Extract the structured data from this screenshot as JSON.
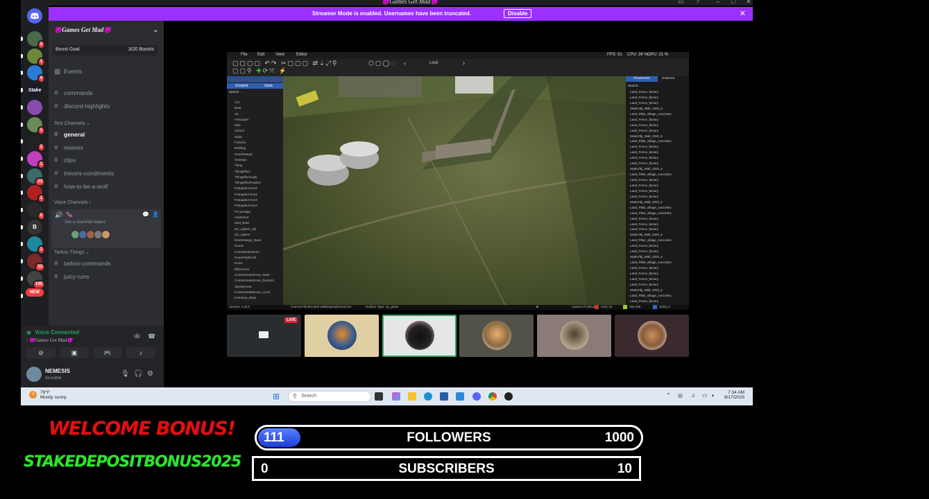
{
  "window": {
    "title": "😈Games Get Mad😈"
  },
  "banner": {
    "message": "Streamer Mode is enabled. Usernames have been truncated.",
    "button": "Disable"
  },
  "server_rail": [
    {
      "label": "",
      "badge": "3"
    },
    {
      "label": "",
      "badge": "1"
    },
    {
      "label": "",
      "badge": "4"
    },
    {
      "label": "Stake",
      "badge": ""
    },
    {
      "label": "",
      "badge": ""
    },
    {
      "label": "",
      "badge": "1"
    },
    {
      "label": "",
      "badge": "1"
    },
    {
      "label": "",
      "badge": "1"
    },
    {
      "label": "",
      "badge": "13"
    },
    {
      "label": "",
      "badge": "1"
    },
    {
      "label": "",
      "badge": "2"
    },
    {
      "label": "B",
      "badge": ""
    },
    {
      "label": "",
      "badge": "1"
    },
    {
      "label": "",
      "badge": "13"
    },
    {
      "label": "",
      "badge": "145"
    },
    {
      "label": "NEW",
      "badge": ""
    }
  ],
  "sidebar": {
    "server_name": "😈Games Get Mad😈",
    "boost_goal": "Boost Goal",
    "boosts": "3/20 Boosts",
    "events": "Events",
    "top_channels": [
      "commands",
      "discord-highlights"
    ],
    "text_category": "Text Channels",
    "text_channels": [
      "general",
      "memes",
      "clips",
      "trevors-condiments",
      "how-to-be-a-wolf"
    ],
    "voice_category": "Voice Channels",
    "voice_status": "Set a channel status",
    "tarkov_category": "Tarkov Things",
    "tarkov_channels": [
      "tarkov-commands",
      "juicy-runs"
    ]
  },
  "voice_panel": {
    "status": "Voice Connected",
    "location": "/ 😈Games Get Mad😈"
  },
  "user_panel": {
    "name": "NEMESIS",
    "status": "Invisible"
  },
  "editor": {
    "menu": [
      "File",
      "Edit",
      "View",
      "Editor"
    ],
    "lock_label": "Lock",
    "fps": "FPS: 51",
    "cpu": "CPU: 39 %",
    "gpu": "GPU: 21 %",
    "left_search": "Search...",
    "left_tabs": [
      "Scripted",
      "Static"
    ],
    "left_items": [
      "Car",
      "Boat",
      "Air",
      "Helicopter",
      "Mob",
      "Animal",
      "Static",
      "Fortress",
      "Building",
      "NonStrategic",
      "Strategic",
      "Thing",
      "ThingEffect",
      "ThingEffectLight",
      "ThingEffectFeather",
      "PoEapdsArmor1",
      "PoEapdsArmor2",
      "PoEapdsArmor3",
      "PoEapdsArmor4",
      "PrCartridge",
      "Adventure",
      "Mod_Base",
      "DZ_LightAI_old",
      "DZ_LightAI",
      "NonStrategic_Base",
      "House",
      "HouseNoDestruct",
      "HouseHighCost",
      "Ruins",
      "EffectArea",
      "ContaminatedArea_Static",
      "ContaminatedArea_Dynamic",
      "SpookyArea",
      "ContaminatedArea_Local",
      "Inventory_Base"
    ],
    "right_tabs": [
      "Placements",
      "Deletions"
    ],
    "right_search": "Search...",
    "right_items": [
      "Land_Fence_factory",
      "Land_Fence_factory",
      "Land_Fence_factory",
      "StaticObj_Wall_CBrk_5",
      "Land_Pillar_village_concrete1",
      "Land_Fence_factory",
      "Land_Fence_factory",
      "Land_Fence_factory",
      "StaticObj_Wall_CBrk_5",
      "Land_Pillar_village_concrete1",
      "Land_Fence_factory",
      "Land_Fence_factory",
      "Land_Fence_factory",
      "Land_Fence_factory",
      "StaticObj_Wall_CBrk_5",
      "Land_Pillar_village_concrete1",
      "Land_Fence_factory",
      "Land_Fence_factory",
      "Land_Fence_factory",
      "Land_Fence_factory",
      "StaticObj_Wall_CBrk_5",
      "Land_Pillar_village_concrete1",
      "Land_Pillar_village_concrete1",
      "Land_Fence_factory",
      "Land_Fence_factory",
      "Land_Fence_factory",
      "StaticObj_Wall_CBrk_5",
      "Land_Pillar_village_concrete1",
      "Land_Fence_factory",
      "Land_Fence_factory",
      "StaticObj_Wall_CBrk_5",
      "Land_Pillar_village_concrete1",
      "Land_Fence_factory",
      "Land_Fence_factory",
      "Land_Fence_factory",
      "Land_Fence_factory",
      "StaticObj_Wall_CBrk_5",
      "Land_Pillar_village_concrete1",
      "Land_Fence_factory",
      "Land_Fence_factory",
      "Land_Fence_factory"
    ],
    "status_version": "Version: 1.34.6",
    "status_file": "Current File:Boosted WallsNpasdermed.dze",
    "status_surface": "Surface Type: cp_grass",
    "camera_label": "Camera Position:",
    "pos_x": "4321.12",
    "pos_y": "392.408",
    "pos_z": "11051.2"
  },
  "webcams": {
    "live_badge": "LIVE"
  },
  "taskbar": {
    "temp": "79°F",
    "weather": "Mostly sunny",
    "weather_badge": "3",
    "search_placeholder": "Search",
    "time": "7:34 AM",
    "date": "8/17/2025"
  },
  "overlay": {
    "welcome": "WELCOME BONUS!",
    "promo_code": "STAKEDEPOSITBONUS2025",
    "followers": {
      "current": "111",
      "label": "FOLLOWERS",
      "goal": "1000",
      "progress": 0.111
    },
    "subscribers": {
      "current": "0",
      "label": "SUBSCRIBERS",
      "goal": "10",
      "progress": 0
    }
  },
  "colors": {
    "streamer_banner": "#9b30ff",
    "discord_bg": "#2b2d31",
    "voice_connected": "#23a55a",
    "welcome_text": "#e01010",
    "promo_text": "#2fe42f",
    "followers_fill": "#1b3ed8"
  }
}
